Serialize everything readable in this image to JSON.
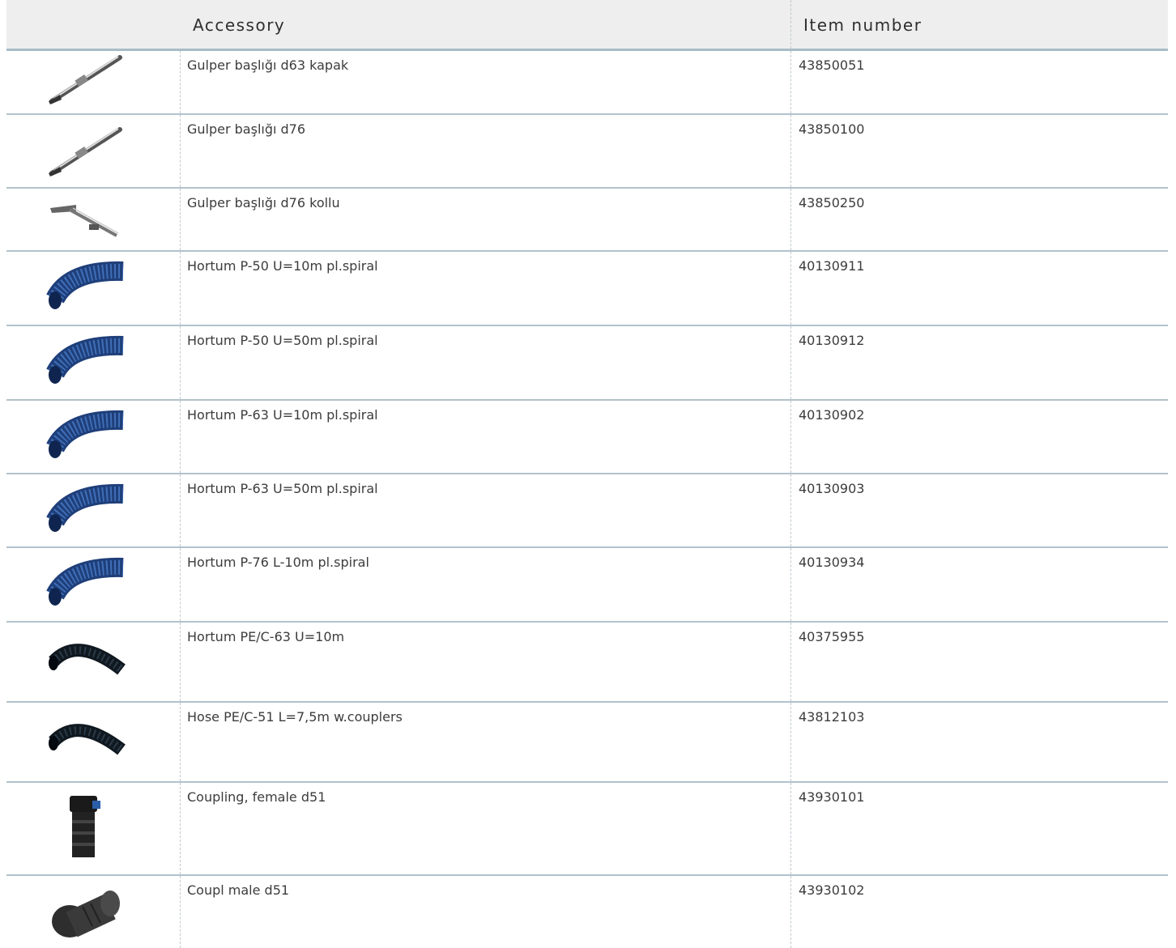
{
  "header": {
    "accessory": "Accessory",
    "item_number": "Item number"
  },
  "rows": [
    {
      "accessory": "Gulper başlığı d63 kapak",
      "item_number": "43850051",
      "icon": "wand-icon"
    },
    {
      "accessory": "Gulper başlığı d76",
      "item_number": "43850100",
      "icon": "wand-icon"
    },
    {
      "accessory": "Gulper başlığı d76 kollu",
      "item_number": "43850250",
      "icon": "squeegee-tool-icon"
    },
    {
      "accessory": "Hortum P-50 U=10m pl.spiral",
      "item_number": "40130911",
      "icon": "blue-hose-icon"
    },
    {
      "accessory": "Hortum P-50 U=50m pl.spiral",
      "item_number": "40130912",
      "icon": "blue-hose-icon"
    },
    {
      "accessory": "Hortum P-63 U=10m pl.spiral",
      "item_number": "40130902",
      "icon": "blue-hose-icon"
    },
    {
      "accessory": "Hortum P-63 U=50m pl.spiral",
      "item_number": "40130903",
      "icon": "blue-hose-icon"
    },
    {
      "accessory": "Hortum P-76 L-10m pl.spiral",
      "item_number": "40130934",
      "icon": "blue-hose-icon"
    },
    {
      "accessory": "Hortum PE/C-63 U=10m",
      "item_number": "40375955",
      "icon": "black-hose-icon"
    },
    {
      "accessory": "Hose PE/C-51 L=7,5m w.couplers",
      "item_number": "43812103",
      "icon": "black-hose-icon"
    },
    {
      "accessory": "Coupling, female d51",
      "item_number": "43930101",
      "icon": "female-coupling-icon"
    },
    {
      "accessory": "Coupl male d51",
      "item_number": "43930102",
      "icon": "male-coupling-icon"
    }
  ]
}
